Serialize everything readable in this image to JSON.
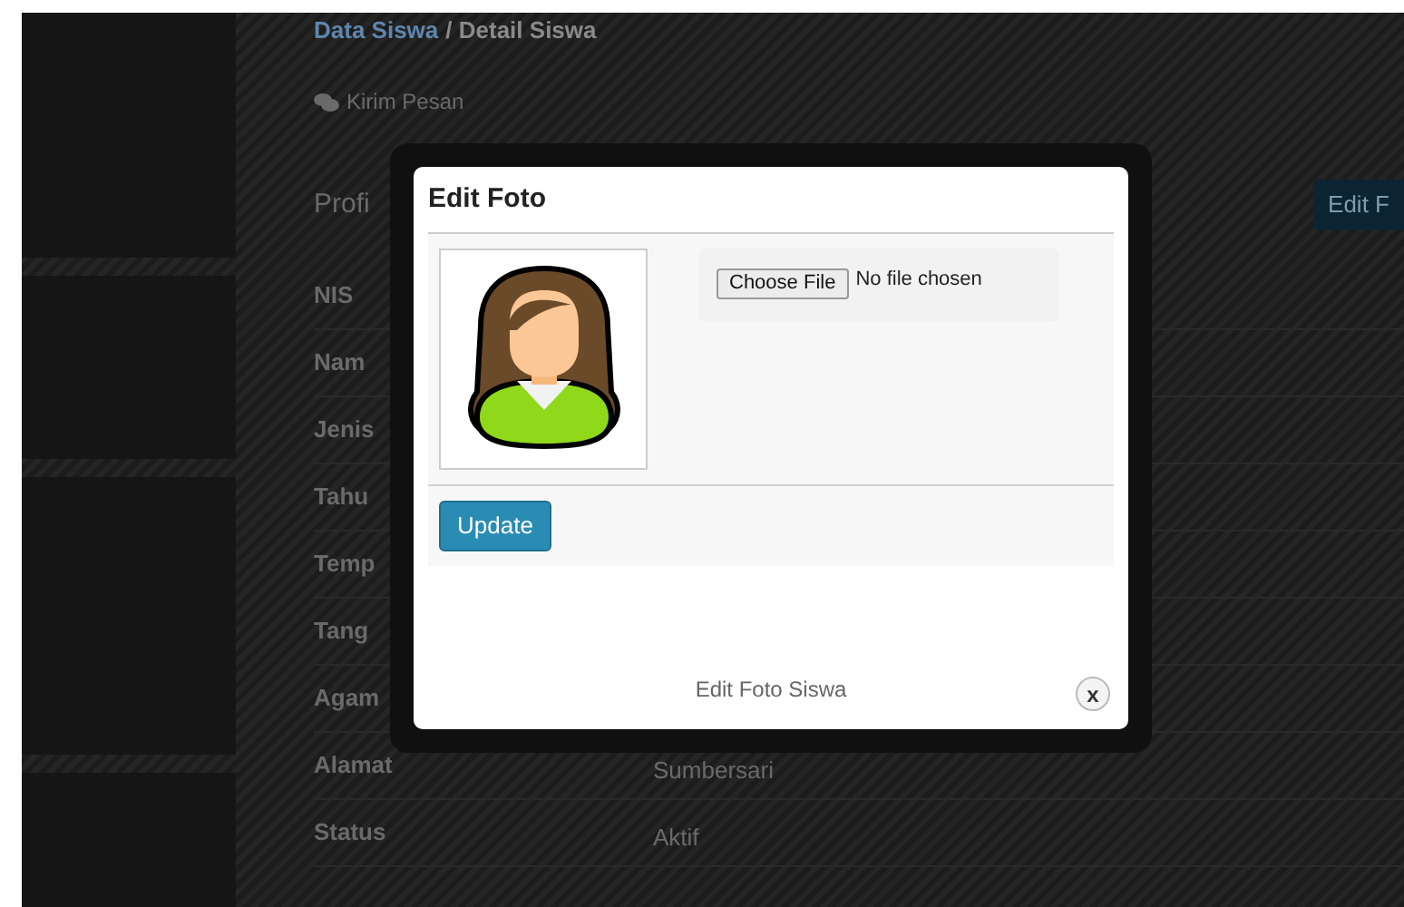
{
  "breadcrumb": {
    "link": "Data Siswa",
    "current": "/ Detail Siswa"
  },
  "message_button": "Kirim Pesan",
  "profile_heading": "Profi",
  "edit_button": "Edit F",
  "rows": [
    {
      "label": "NIS"
    },
    {
      "label": "Nam"
    },
    {
      "label": "Jenis"
    },
    {
      "label": "Tahu"
    },
    {
      "label": "Temp"
    },
    {
      "label": "Tang"
    },
    {
      "label": "Agam"
    },
    {
      "label": "Alamat",
      "value": "Sumbersari"
    },
    {
      "label": "Status",
      "value": "Aktif"
    }
  ],
  "modal": {
    "title": "Edit Foto",
    "file_button": "Choose File",
    "file_status": "No file chosen",
    "submit": "Update",
    "footer": "Edit Foto Siswa",
    "close": "x"
  }
}
